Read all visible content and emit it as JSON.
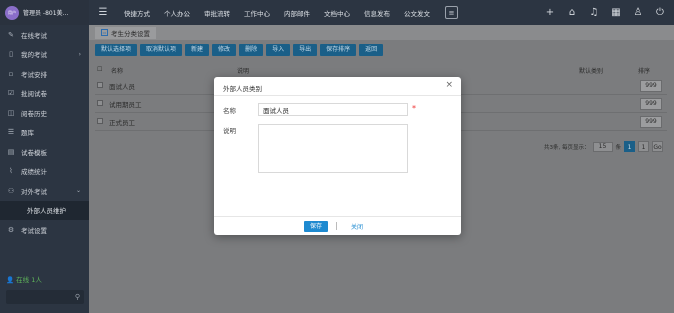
{
  "sidebar": {
    "user_name": "管理员 -801美...",
    "avatar_text": "用户",
    "items": [
      {
        "label": "在线考试",
        "icon": "edit-icon"
      },
      {
        "label": "我的考试",
        "icon": "book-icon",
        "chevron": "›"
      },
      {
        "label": "考试安排",
        "icon": "file-icon"
      },
      {
        "label": "批阅试卷",
        "icon": "check-icon"
      },
      {
        "label": "阅卷历史",
        "icon": "history-icon"
      },
      {
        "label": "题库",
        "icon": "list-icon"
      },
      {
        "label": "试卷模板",
        "icon": "template-icon"
      },
      {
        "label": "成绩统计",
        "icon": "chart-icon"
      },
      {
        "label": "对外考试",
        "icon": "users-icon",
        "chevron": "⌄"
      },
      {
        "label": "外部人员维护",
        "icon": ""
      },
      {
        "label": "考试设置",
        "icon": "gear-icon"
      }
    ],
    "online_status": "在线 1人"
  },
  "topbar": {
    "nav": [
      "快捷方式",
      "个人办公",
      "审批流转",
      "工作中心",
      "内部邮件",
      "文档中心",
      "信息发布",
      "公文发文"
    ]
  },
  "tab": {
    "label": "考生分类设置"
  },
  "toolbar": {
    "buttons": [
      "默认选择项",
      "取消默认项",
      "新建",
      "修改",
      "删除",
      "导入",
      "导出",
      "保存排序",
      "返回"
    ]
  },
  "table": {
    "headers": {
      "name": "名称",
      "desc": "说明",
      "default": "默认类别",
      "order": "排序"
    },
    "rows": [
      {
        "name": "面试人员",
        "order": "999"
      },
      {
        "name": "试用期员工",
        "order": "999"
      },
      {
        "name": "正式员工",
        "order": "999"
      }
    ]
  },
  "pager": {
    "summary": "共3条, 每页显示：",
    "page_size": "15",
    "unit": "条",
    "current": "1",
    "total": "1",
    "go": "Go"
  },
  "dialog": {
    "title": "外部人员类别",
    "name_label": "名称",
    "name_value": "面试人员",
    "required_mark": "*",
    "desc_label": "说明",
    "save_label": "保存",
    "close_label": "关闭"
  }
}
